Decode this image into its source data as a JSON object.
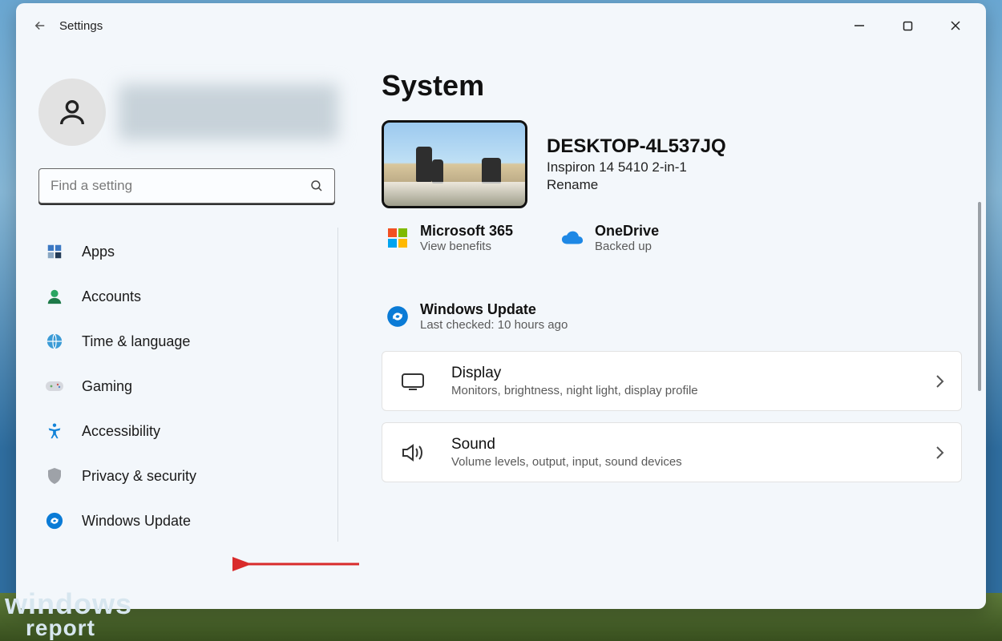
{
  "app": {
    "title": "Settings"
  },
  "search": {
    "placeholder": "Find a setting"
  },
  "sidebar": {
    "items": [
      {
        "label": "Apps",
        "icon": "apps-icon"
      },
      {
        "label": "Accounts",
        "icon": "accounts-icon"
      },
      {
        "label": "Time & language",
        "icon": "time-language-icon"
      },
      {
        "label": "Gaming",
        "icon": "gaming-icon"
      },
      {
        "label": "Accessibility",
        "icon": "accessibility-icon"
      },
      {
        "label": "Privacy & security",
        "icon": "privacy-security-icon"
      },
      {
        "label": "Windows Update",
        "icon": "windows-update-icon"
      }
    ]
  },
  "main": {
    "title": "System",
    "device": {
      "name": "DESKTOP-4L537JQ",
      "model": "Inspiron 14 5410 2-in-1",
      "rename_label": "Rename"
    },
    "tiles": {
      "m365": {
        "title": "Microsoft 365",
        "sub": "View benefits"
      },
      "onedrive": {
        "title": "OneDrive",
        "sub": "Backed up"
      },
      "update": {
        "title": "Windows Update",
        "sub": "Last checked: 10 hours ago"
      }
    },
    "cards": [
      {
        "id": "display",
        "title": "Display",
        "sub": "Monitors, brightness, night light, display profile"
      },
      {
        "id": "sound",
        "title": "Sound",
        "sub": "Volume levels, output, input, sound devices"
      }
    ]
  },
  "annotation": {
    "highlight": "windows-update"
  },
  "watermark": {
    "line1": "windows",
    "line2": "report"
  },
  "colors": {
    "accent": "#0067c0",
    "annotation_arrow": "#d92b2b"
  }
}
